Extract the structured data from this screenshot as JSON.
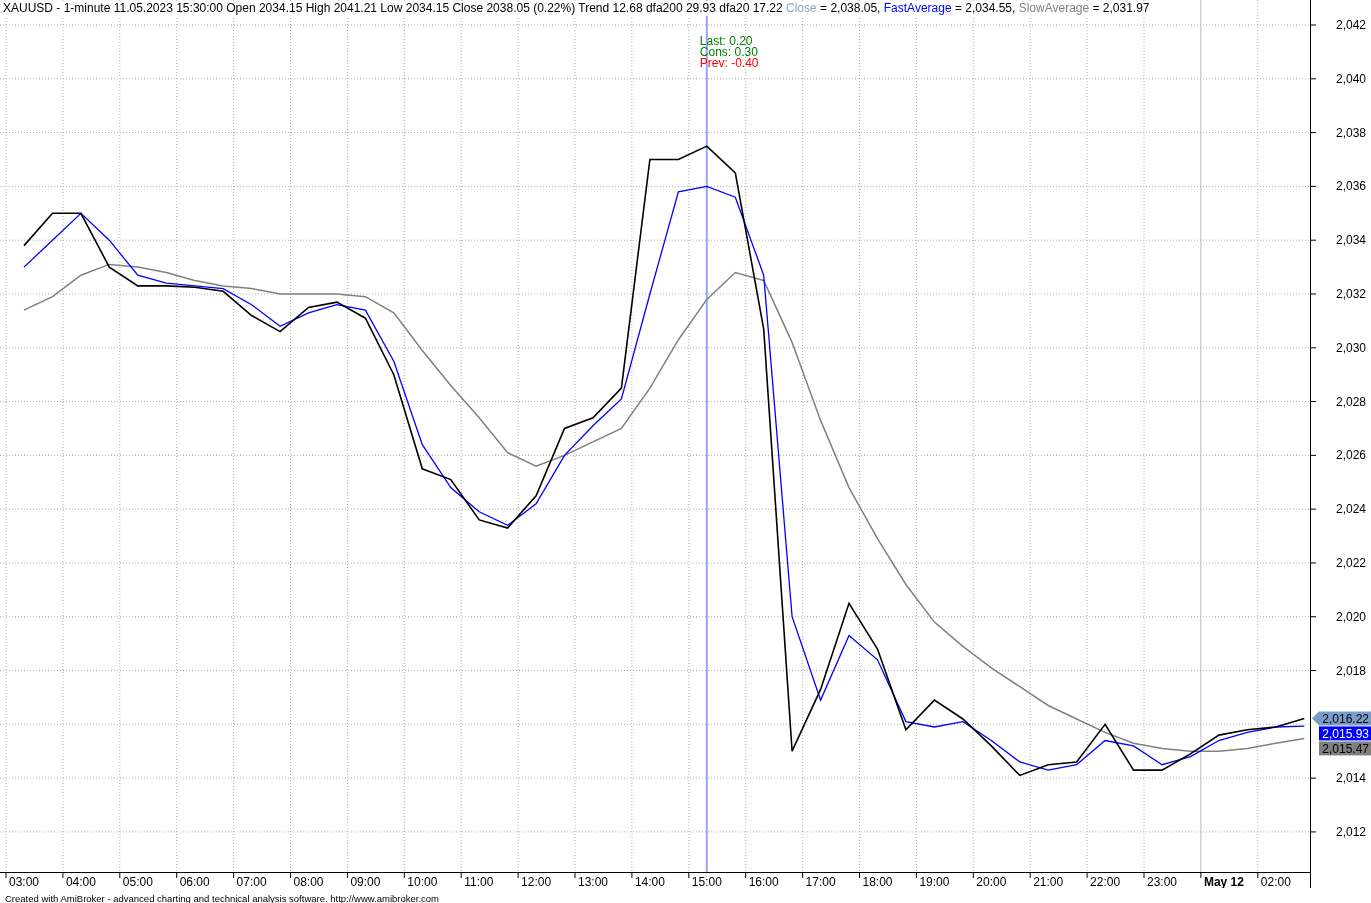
{
  "header": {
    "title": "XAUUSD - 1-minute 11.05.2023 15:30:00 Open 2034.15 High 2041.21 Low 2034.15 Close 2038.05 (0.22%) Trend 12.68 dfa200 29.93 dfa20 17.22",
    "legend": [
      {
        "color": "#8ea3c8",
        "value": "= 2,038.05,"
      },
      {
        "color": "#0000ff",
        "value": "= 2,034.55,"
      },
      {
        "color": "#808080",
        "value": "= 2,031.97"
      }
    ]
  },
  "chart": {
    "chart_data": {
      "type": "line",
      "grid": true,
      "categories": [
        "03:00",
        null,
        "04:00",
        null,
        "05:00",
        null,
        "06:00",
        null,
        "07:00",
        null,
        "08:00",
        null,
        "09:00",
        null,
        "10:00",
        null,
        "11:00",
        null,
        "12:00",
        null,
        "13:00",
        null,
        "14:00",
        null,
        "15:00",
        null,
        "16:00",
        null,
        "17:00",
        null,
        "18:00",
        null,
        "19:00",
        null,
        "20:00",
        null,
        "21:00",
        null,
        "22:00",
        null,
        "23:00",
        null,
        "May 12",
        null,
        "02:00",
        null
      ],
      "series": [
        {
          "name": "Close",
          "color": "#000000",
          "values": [
            2033.8,
            2035.0,
            2035.0,
            2033.0,
            2032.3,
            2032.3,
            2032.25,
            2032.1,
            2031.2,
            2030.6,
            2031.5,
            2031.7,
            2031.1,
            2029.0,
            2025.5,
            2025.1,
            2023.6,
            2023.3,
            2024.5,
            2027.0,
            2027.4,
            2028.5,
            2037.0,
            2037.0,
            2037.5,
            2036.5,
            2030.7,
            2015.0,
            2017.3,
            2020.5,
            2018.8,
            2015.8,
            2016.9,
            2016.2,
            2015.2,
            2014.1,
            2014.5,
            2014.6,
            2016.0,
            2014.3,
            2014.3,
            2014.9,
            2015.6,
            2015.8,
            2015.9,
            2016.22
          ]
        },
        {
          "name": "FastAverage",
          "color": "#0000ff",
          "values": [
            2033.0,
            2034.0,
            2035.0,
            2034.0,
            2032.7,
            2032.4,
            2032.3,
            2032.2,
            2031.6,
            2030.8,
            2031.3,
            2031.6,
            2031.4,
            2029.5,
            2026.4,
            2024.8,
            2023.9,
            2023.4,
            2024.2,
            2026.0,
            2027.1,
            2028.1,
            2032.0,
            2035.8,
            2036.0,
            2035.6,
            2032.7,
            2020.0,
            2016.9,
            2019.3,
            2018.4,
            2016.1,
            2015.9,
            2016.1,
            2015.4,
            2014.6,
            2014.3,
            2014.5,
            2015.4,
            2015.2,
            2014.5,
            2014.8,
            2015.4,
            2015.7,
            2015.9,
            2015.93
          ]
        },
        {
          "name": "SlowAverage",
          "color": "#808080",
          "values": [
            2031.4,
            2031.9,
            2032.7,
            2033.1,
            2033.0,
            2032.8,
            2032.5,
            2032.3,
            2032.2,
            2032.0,
            2032.0,
            2032.0,
            2031.9,
            2031.3,
            2029.9,
            2028.6,
            2027.4,
            2026.1,
            2025.6,
            2026.0,
            2026.5,
            2027.0,
            2028.5,
            2030.3,
            2031.8,
            2032.8,
            2032.5,
            2030.2,
            2027.3,
            2024.8,
            2022.9,
            2021.2,
            2019.8,
            2018.9,
            2018.1,
            2017.4,
            2016.7,
            2016.2,
            2015.7,
            2015.3,
            2015.1,
            2015.0,
            2015.0,
            2015.1,
            2015.3,
            2015.47
          ]
        }
      ],
      "ylim": [
        2010.51,
        2042.93
      ],
      "yticks": [
        {
          "value": 2012,
          "label": "2,012"
        },
        {
          "value": 2014,
          "label": "2,014"
        },
        {
          "value": 2018,
          "label": "2,018"
        },
        {
          "value": 2020,
          "label": "2,020"
        },
        {
          "value": 2022,
          "label": "2,022"
        },
        {
          "value": 2024,
          "label": "2,024"
        },
        {
          "value": 2026,
          "label": "2,026"
        },
        {
          "value": 2028,
          "label": "2,028"
        },
        {
          "value": 2030,
          "label": "2,030"
        },
        {
          "value": 2032,
          "label": "2,032"
        },
        {
          "value": 2034,
          "label": "2,034"
        },
        {
          "value": 2036,
          "label": "2,036"
        },
        {
          "value": 2038,
          "label": "2,038"
        },
        {
          "value": 2040,
          "label": "2,040"
        },
        {
          "value": 2042,
          "label": "2,042"
        }
      ]
    },
    "cursor": {
      "color": "#a0a0ff"
    },
    "cursor_labels": [
      {
        "text": "Last: 0.20",
        "color": "#008000"
      },
      {
        "text": "Cons: 0.30",
        "color": "#008000"
      },
      {
        "text": "Prev: -0.40",
        "color": "#ff0000"
      }
    ],
    "price_labels": [
      {
        "text": "2,016.22",
        "color": "#7a9cc8",
        "kind": "flag"
      },
      {
        "text": "2,015.93",
        "color": "#0000ff",
        "kind": "box"
      },
      {
        "text": "2,015.47",
        "color": "#808080",
        "kind": "box"
      }
    ]
  },
  "footer": "Created with AmiBroker - advanced charting and technical analysis software. http://www.amibroker.com"
}
